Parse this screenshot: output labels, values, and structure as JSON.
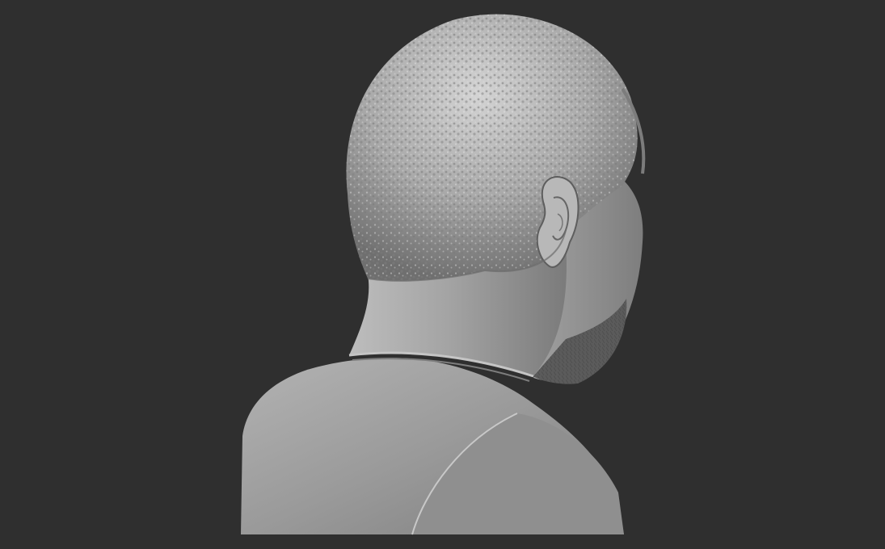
{
  "scene": {
    "subject": "bust-back-view",
    "background_color": "#2f2f2f",
    "material_color": "#9c9c9c",
    "highlight_color": "#d8d8d8",
    "shadow_color": "#5a5a5a"
  }
}
